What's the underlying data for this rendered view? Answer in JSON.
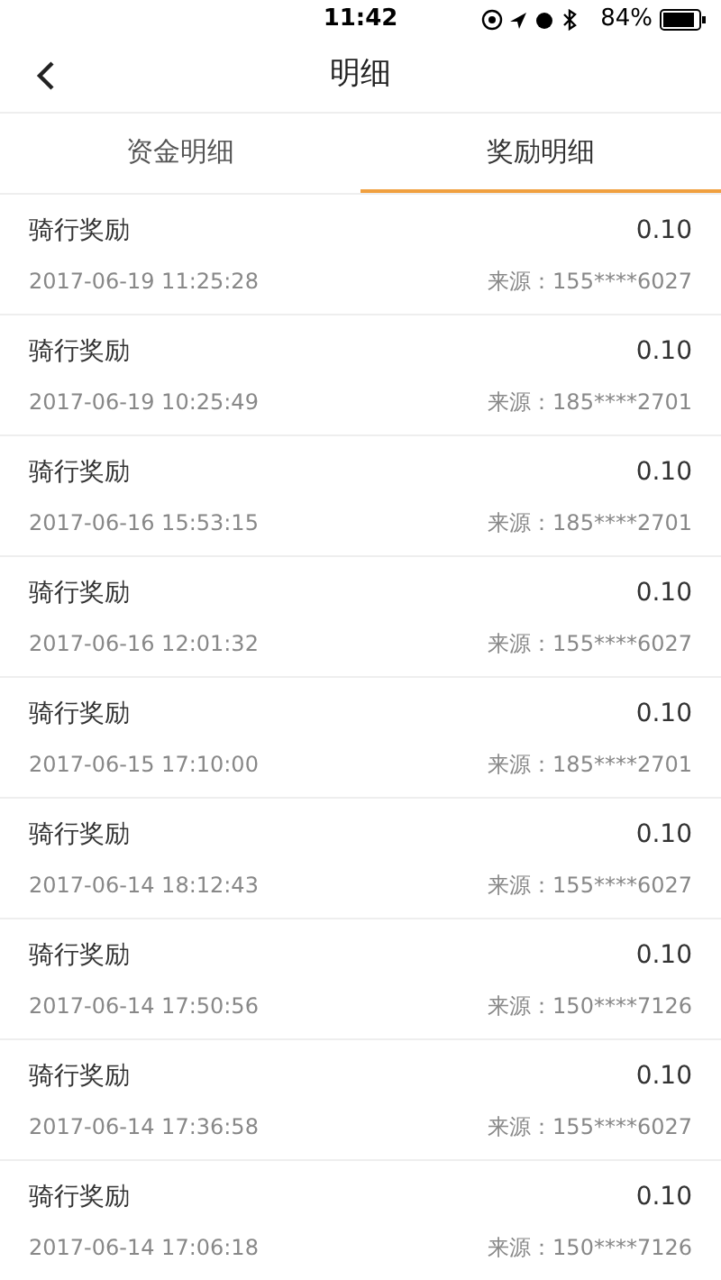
{
  "status_bar": {
    "time": "11:42",
    "battery": "84%"
  },
  "nav": {
    "title": "明细"
  },
  "tabs": [
    {
      "label": "资金明细",
      "selected": false
    },
    {
      "label": "奖励明细",
      "selected": true
    }
  ],
  "records": [
    {
      "title": "骑行奖励",
      "time": "2017-06-19 11:25:28",
      "amount": "0.10",
      "source": "来源：155****6027"
    },
    {
      "title": "骑行奖励",
      "time": "2017-06-19 10:25:49",
      "amount": "0.10",
      "source": "来源：185****2701"
    },
    {
      "title": "骑行奖励",
      "time": "2017-06-16 15:53:15",
      "amount": "0.10",
      "source": "来源：185****2701"
    },
    {
      "title": "骑行奖励",
      "time": "2017-06-16 12:01:32",
      "amount": "0.10",
      "source": "来源：155****6027"
    },
    {
      "title": "骑行奖励",
      "time": "2017-06-15 17:10:00",
      "amount": "0.10",
      "source": "来源：185****2701"
    },
    {
      "title": "骑行奖励",
      "time": "2017-06-14 18:12:43",
      "amount": "0.10",
      "source": "来源：155****6027"
    },
    {
      "title": "骑行奖励",
      "time": "2017-06-14 17:50:56",
      "amount": "0.10",
      "source": "来源：150****7126"
    },
    {
      "title": "骑行奖励",
      "time": "2017-06-14 17:36:58",
      "amount": "0.10",
      "source": "来源：155****6027"
    },
    {
      "title": "骑行奖励",
      "time": "2017-06-14 17:06:18",
      "amount": "0.10",
      "source": "来源：150****7126"
    }
  ]
}
